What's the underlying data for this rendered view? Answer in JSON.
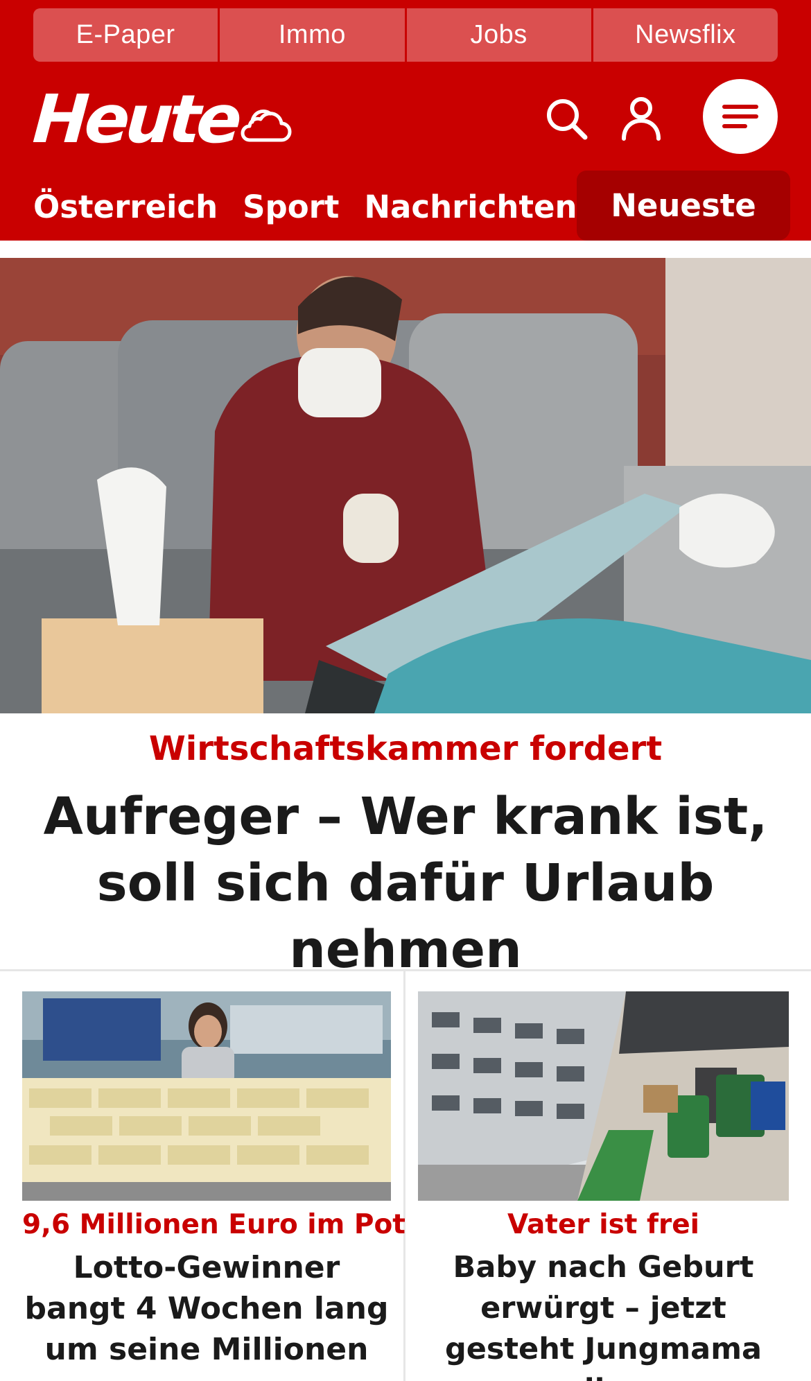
{
  "topnav": {
    "items": [
      {
        "label": "E-Paper"
      },
      {
        "label": "Immo"
      },
      {
        "label": "Jobs"
      },
      {
        "label": "Newsflix"
      }
    ]
  },
  "header": {
    "logo": "Heute",
    "icons": [
      "weather-cloud-icon",
      "search-icon",
      "user-icon",
      "menu-icon"
    ]
  },
  "sections": {
    "items": [
      {
        "label": "Österreich"
      },
      {
        "label": "Sport"
      },
      {
        "label": "Nachrichten"
      }
    ],
    "active": "Neueste"
  },
  "lead": {
    "kicker": "Wirtschaftskammer fordert",
    "title": "Aufreger – Wer krank ist, soll sich dafür Urlaub nehmen"
  },
  "teasers": [
    {
      "kicker": "9,6 Millionen Euro im Pot",
      "title": "Lotto-Gewinner bangt 4 Wochen lang um seine Millionen"
    },
    {
      "kicker": "Vater ist frei",
      "title": "Baby nach Geburt erwürgt – jetzt gesteht Jungmama alles"
    }
  ],
  "colors": {
    "brand_red": "#c90000",
    "topnav_red": "#db5050",
    "active_tab_red": "#a50000",
    "text_dark": "#1a1a1a"
  }
}
